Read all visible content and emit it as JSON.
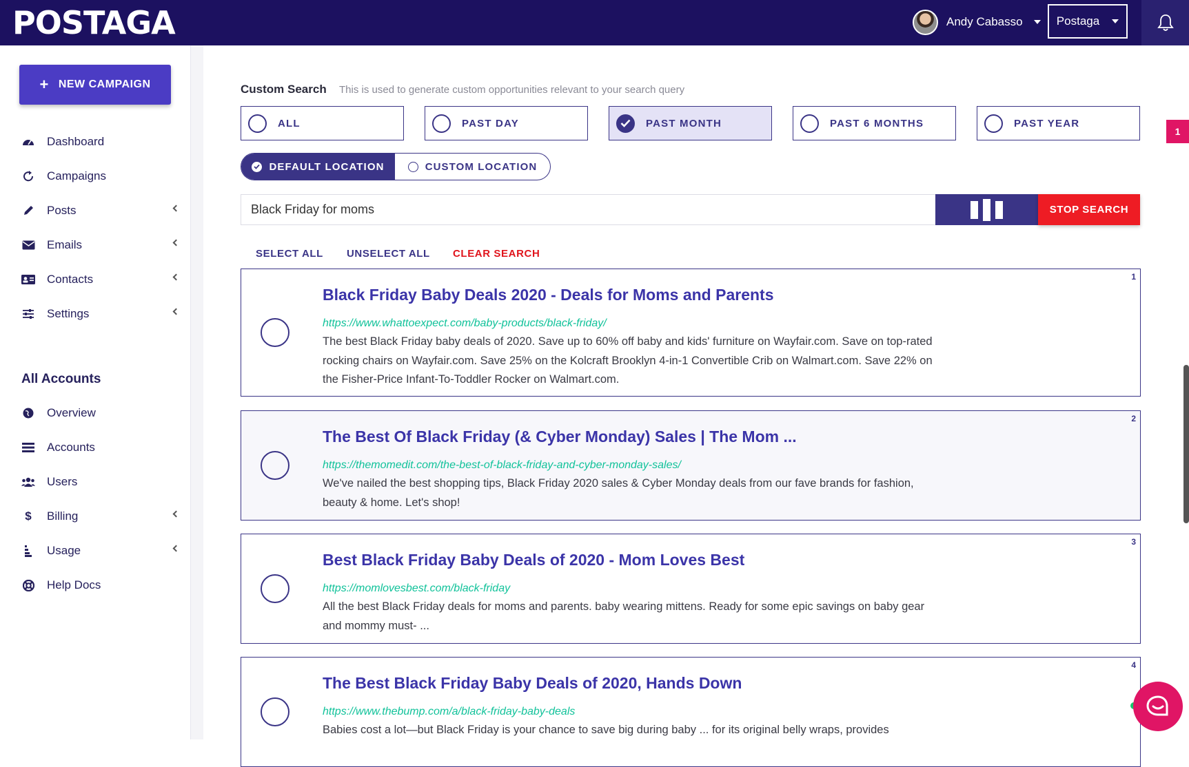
{
  "topbar": {
    "logo": "POSTAGA",
    "user_name": "Andy Cabasso",
    "org_name": "Postaga"
  },
  "sidebar": {
    "new_campaign_label": "NEW CAMPAIGN",
    "items": [
      {
        "label": "Dashboard"
      },
      {
        "label": "Campaigns"
      },
      {
        "label": "Posts"
      },
      {
        "label": "Emails"
      },
      {
        "label": "Contacts"
      },
      {
        "label": "Settings"
      }
    ],
    "section_title": "All Accounts",
    "account_items": [
      {
        "label": "Overview"
      },
      {
        "label": "Accounts"
      },
      {
        "label": "Users"
      },
      {
        "label": "Billing"
      },
      {
        "label": "Usage"
      },
      {
        "label": "Help Docs"
      }
    ]
  },
  "custom_search": {
    "title": "Custom Search",
    "hint": "This is used to generate custom opportunities relevant to your search query",
    "time_options": [
      {
        "label": "ALL",
        "selected": false
      },
      {
        "label": "PAST DAY",
        "selected": false
      },
      {
        "label": "PAST MONTH",
        "selected": true
      },
      {
        "label": "PAST 6 MONTHS",
        "selected": false
      },
      {
        "label": "PAST YEAR",
        "selected": false
      }
    ],
    "location_options": [
      {
        "label": "DEFAULT LOCATION",
        "selected": true
      },
      {
        "label": "CUSTOM LOCATION",
        "selected": false
      }
    ],
    "query": "Black Friday for moms",
    "stop_label": "STOP SEARCH",
    "select_all": "SELECT ALL",
    "unselect_all": "UNSELECT ALL",
    "clear_search": "CLEAR SEARCH"
  },
  "results": [
    {
      "num": "1",
      "title": "Black Friday Baby Deals 2020 - Deals for Moms and Parents",
      "url": "https://www.whattoexpect.com/baby-products/black-friday/",
      "desc": "The best Black Friday baby deals of 2020. Save up to 60% off baby and kids' furniture on Wayfair.com. Save on top-rated rocking chairs on Wayfair.com. Save 25% on the Kolcraft Brooklyn 4-in-1 Convertible Crib on Walmart.com. Save 22% on the Fisher-Price Infant-To-Toddler Rocker on Walmart.com."
    },
    {
      "num": "2",
      "title": "The Best Of Black Friday (& Cyber Monday) Sales | The Mom ...",
      "url": "https://themomedit.com/the-best-of-black-friday-and-cyber-monday-sales/",
      "desc": "We've nailed the best shopping tips, Black Friday 2020 sales & Cyber Monday deals from our fave brands for fashion, beauty & home. Let's shop!"
    },
    {
      "num": "3",
      "title": "Best Black Friday Baby Deals of 2020 - Mom Loves Best",
      "url": "https://momlovesbest.com/black-friday",
      "desc": "All the best Black Friday deals for moms and parents. baby wearing mittens. Ready for some epic savings on baby gear and mommy must- ..."
    },
    {
      "num": "4",
      "title": "The Best Black Friday Baby Deals of 2020, Hands Down",
      "url": "https://www.thebump.com/a/black-friday-baby-deals",
      "desc": "Babies cost a lot—but Black Friday is your chance to save big during baby ... for its original belly wraps, provides"
    }
  ],
  "notification_badge": "1",
  "colors": {
    "topbar": "#1c1160",
    "primary": "#3a3486",
    "button": "#4b3cc4",
    "stop": "#ee1c24",
    "url": "#11c29a",
    "chat": "#e01565"
  }
}
